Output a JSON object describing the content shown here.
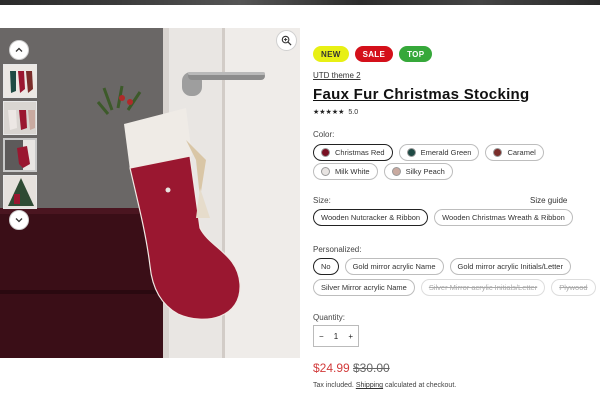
{
  "badges": {
    "new": "NEW",
    "sale": "SALE",
    "top": "TOP"
  },
  "product": {
    "vendor": "UTD theme 2",
    "title": "Faux Fur Christmas Stocking",
    "stars": "★★★★★",
    "rating": "5.0"
  },
  "color": {
    "label": "Color:",
    "options": [
      {
        "label": "Christmas Red",
        "swatch": "#7a1023",
        "selected": true
      },
      {
        "label": "Emerald Green",
        "swatch": "#1f4a44"
      },
      {
        "label": "Caramel",
        "swatch": "#7a2d2a"
      },
      {
        "label": "Milk White",
        "swatch": "#e8e4e2"
      },
      {
        "label": "Silky Peach",
        "swatch": "#c9aaa0"
      }
    ]
  },
  "size": {
    "label": "Size:",
    "guide": "Size guide",
    "options": [
      "Wooden Nutcracker & Ribbon",
      "Wooden Christmas Wreath & Ribbon"
    ]
  },
  "personalized": {
    "label": "Personalized:",
    "options": [
      "No",
      "Gold mirror acrylic Name",
      "Gold mirror acrylic Initials/Letter",
      "Silver Mirror acrylic Name",
      "Silver Mirror acrylic Initials/Letter",
      "Plywood"
    ]
  },
  "quantity": {
    "label": "Quantity:",
    "value": "1",
    "minus": "−",
    "plus": "+"
  },
  "price": {
    "sale": "$24.99",
    "old": "$30.00"
  },
  "tax": {
    "before": "Tax included. ",
    "link": "Shipping",
    "after": " calculated at checkout."
  },
  "colors": {
    "sale": "#d4101a",
    "new": "#e8f014",
    "top": "#36a83a",
    "price": "#d23b3b"
  }
}
